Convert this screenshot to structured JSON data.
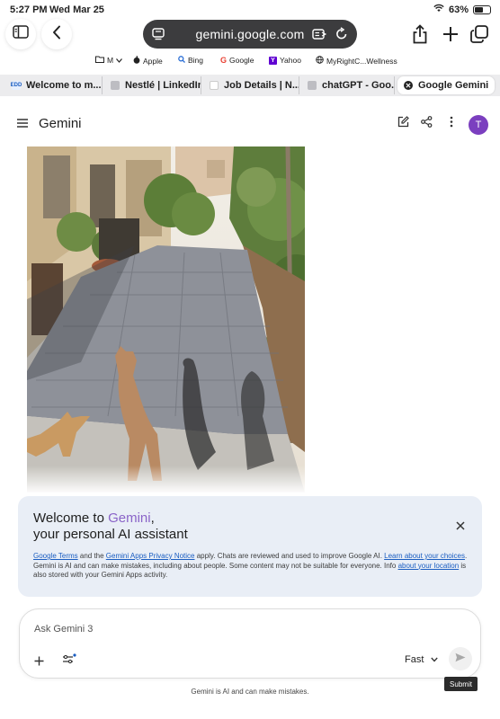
{
  "status_bar": {
    "time": "5:27 PM",
    "date": "Wed Mar 25",
    "battery_percent": "63%",
    "battery_level": 0.63
  },
  "browser": {
    "url": "gemini.google.com",
    "bookmarks": [
      {
        "label": "M",
        "icon": "folder-icon"
      },
      {
        "label": "Apple",
        "icon": "apple-icon"
      },
      {
        "label": "Bing",
        "icon": "search-icon"
      },
      {
        "label": "Google",
        "icon": "google-icon"
      },
      {
        "label": "Yahoo",
        "icon": "yahoo-icon"
      },
      {
        "label": "MyRightC...Wellness",
        "icon": "globe-icon"
      }
    ],
    "tabs": [
      {
        "label": "Welcome to m..."
      },
      {
        "label": "Nestlé | LinkedIn"
      },
      {
        "label": "Job Details | N..."
      },
      {
        "label": "chatGPT - Goo..."
      },
      {
        "label": "Google Gemini",
        "active": true
      }
    ]
  },
  "app": {
    "title": "Gemini",
    "avatar_letter": "T",
    "accent_color": "#7b3fbf"
  },
  "welcome_card": {
    "line1_prefix": "Welcome to ",
    "line1_brand": "Gemini",
    "line1_suffix": ",",
    "line2": "your personal AI assistant",
    "fine_print": {
      "link1": "Google Terms",
      "text1": " and the ",
      "link2": "Gemini Apps Privacy Notice",
      "text2": " apply. Chats are reviewed and used to improve Google AI. ",
      "link3": "Learn about your choices",
      "text3": ". Gemini is AI and can make mistakes, including about people. Some content may not be suitable for everyone. Info ",
      "link4": "about your location",
      "text4": " is also stored with your Gemini Apps activity."
    }
  },
  "composer": {
    "placeholder": "Ask Gemini 3",
    "mode_label": "Fast",
    "submit_tooltip": "Submit"
  },
  "footer_note": "Gemini is AI and can make mistakes."
}
